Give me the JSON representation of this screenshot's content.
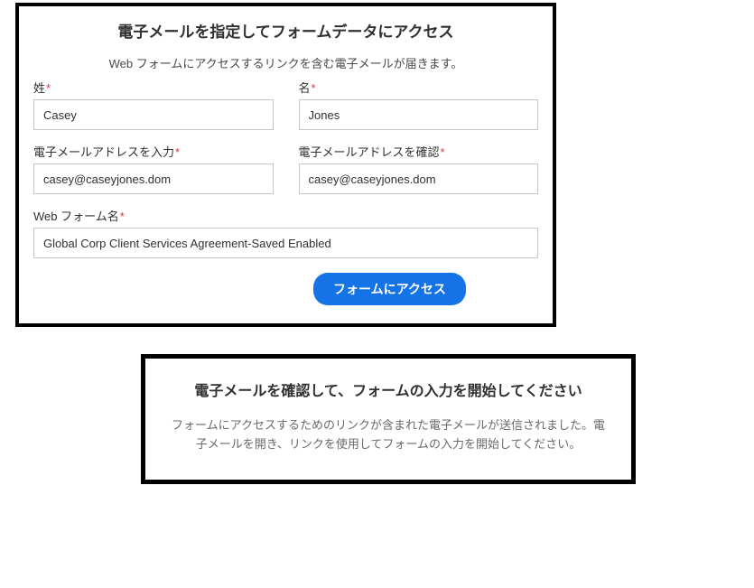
{
  "top": {
    "title": "電子メールを指定してフォームデータにアクセス",
    "subtitle": "Web フォームにアクセスするリンクを含む電子メールが届きます。",
    "lastName": {
      "label": "姓",
      "value": "Casey"
    },
    "firstName": {
      "label": "名",
      "value": "Jones"
    },
    "email": {
      "label": "電子メールアドレスを入力",
      "value": "casey@caseyjones.dom"
    },
    "emailConfirm": {
      "label": "電子メールアドレスを確認",
      "value": "casey@caseyjones.dom"
    },
    "formName": {
      "label": "Web フォーム名",
      "value": "Global Corp Client Services Agreement-Saved Enabled"
    },
    "button": "フォームにアクセス",
    "required": "*"
  },
  "bottom": {
    "title": "電子メールを確認して、フォームの入力を開始してください",
    "body": "フォームにアクセスするためのリンクが含まれた電子メールが送信されました。電子メールを開き、リンクを使用してフォームの入力を開始してください。"
  }
}
